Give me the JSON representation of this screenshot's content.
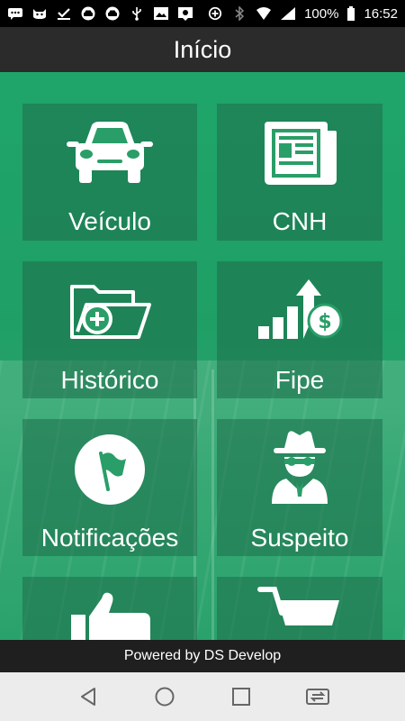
{
  "status_bar": {
    "battery": "100%",
    "time": "16:52",
    "left_icons": [
      "chat-icon",
      "cat-icon",
      "download-done-icon",
      "car-icon",
      "car-icon",
      "usb-icon",
      "image-icon",
      "photo-icon"
    ],
    "right_icons": [
      "data-saver-icon",
      "bluetooth-icon",
      "wifi-icon",
      "signal-icon",
      "battery-icon"
    ]
  },
  "header": {
    "title": "Início"
  },
  "menu": {
    "items": [
      {
        "id": "veiculo",
        "label": "Veículo",
        "icon": "car-icon"
      },
      {
        "id": "cnh",
        "label": "CNH",
        "icon": "newspaper-icon"
      },
      {
        "id": "historico",
        "label": "Histórico",
        "icon": "folder-add-icon"
      },
      {
        "id": "fipe",
        "label": "Fipe",
        "icon": "chart-money-icon"
      },
      {
        "id": "notificacoes",
        "label": "Notificações",
        "icon": "flag-icon"
      },
      {
        "id": "suspeito",
        "label": "Suspeito",
        "icon": "spy-icon"
      },
      {
        "id": "like",
        "label": "",
        "icon": "thumbs-up-icon"
      },
      {
        "id": "cart",
        "label": "",
        "icon": "cart-icon"
      }
    ]
  },
  "footer": {
    "text": "Powered by DS Develop"
  },
  "nav_bar": {
    "buttons": [
      "back-icon",
      "home-icon",
      "recents-icon",
      "switch-apps-icon"
    ]
  },
  "colors": {
    "primary_green": "#1fa56a",
    "title_bar": "#2b2b2b",
    "footer": "#1f1f1f",
    "nav_bar": "#ececec"
  }
}
